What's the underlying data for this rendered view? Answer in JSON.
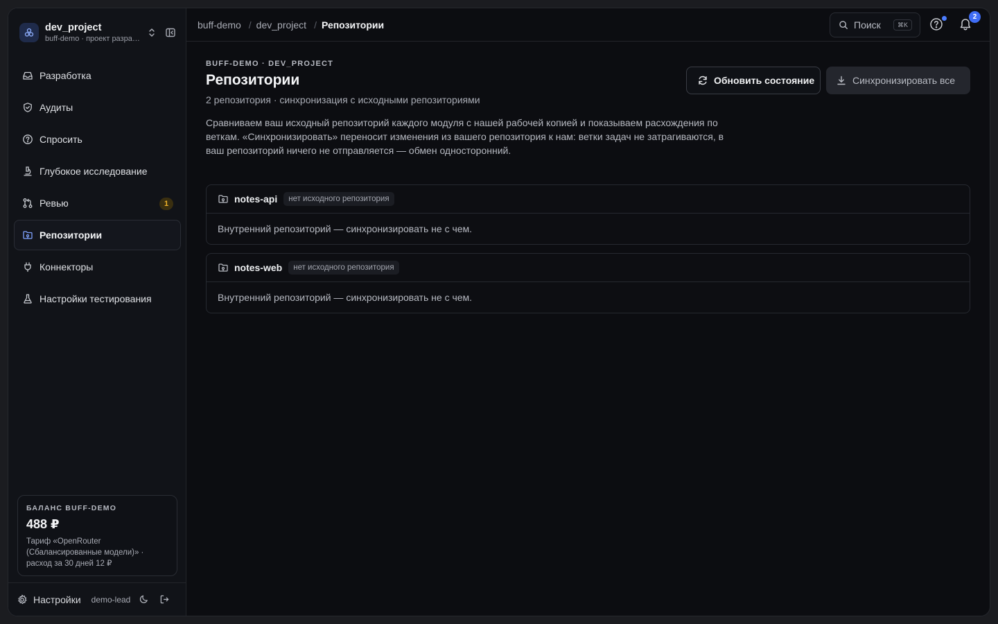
{
  "sidebar": {
    "project_name": "dev_project",
    "project_sub": "buff-demo · проект разработки",
    "nav": [
      {
        "label": "Разработка",
        "icon": "inbox-icon"
      },
      {
        "label": "Аудиты",
        "icon": "shield-icon"
      },
      {
        "label": "Спросить",
        "icon": "question-icon"
      },
      {
        "label": "Глубокое исследование",
        "icon": "microscope-icon"
      },
      {
        "label": "Ревью",
        "icon": "git-pull-request-icon",
        "badge": "1"
      },
      {
        "label": "Репозитории",
        "icon": "folder-git-icon",
        "active": true
      },
      {
        "label": "Коннекторы",
        "icon": "plug-icon"
      },
      {
        "label": "Настройки тестирования",
        "icon": "flask-icon"
      }
    ],
    "balance": {
      "label": "БАЛАНС BUFF-DEMO",
      "amount": "488 ₽",
      "desc": "Тариф «OpenRouter (Сбалансированные модели)» · расход за 30 дней 12 ₽"
    },
    "footer": {
      "settings_label": "Настройки",
      "user": "demo-lead"
    }
  },
  "topbar": {
    "breadcrumbs": [
      "buff-demo",
      "dev_project",
      "Репозитории"
    ],
    "search_label": "Поиск",
    "search_kbd": "⌘K",
    "notifications_count": "2"
  },
  "page": {
    "eyebrow": "BUFF-DEMO · DEV_PROJECT",
    "title": "Репозитории",
    "subtitle": "2 репозитория · синхронизация с исходными репозиториями",
    "description": "Сравниваем ваш исходный репозиторий каждого модуля с нашей рабочей копией и показываем расхождения по веткам. «Синхронизировать» переносит изменения из вашего репозитория к нам: ветки задач не затрагиваются, в ваш репозиторий ничего не отправляется — обмен односторонний.",
    "refresh_label": "Обновить состояние",
    "sync_all_label": "Синхронизировать все"
  },
  "repos": [
    {
      "name": "notes-api",
      "tag": "нет исходного репозитория",
      "message": "Внутренний репозиторий — синхронизировать не с чем."
    },
    {
      "name": "notes-web",
      "tag": "нет исходного репозитория",
      "message": "Внутренний репозиторий — синхронизировать не с чем."
    }
  ],
  "colors": {
    "accent": "#3f6df5",
    "badge": "#f0b429",
    "background": "#0c0d11"
  }
}
